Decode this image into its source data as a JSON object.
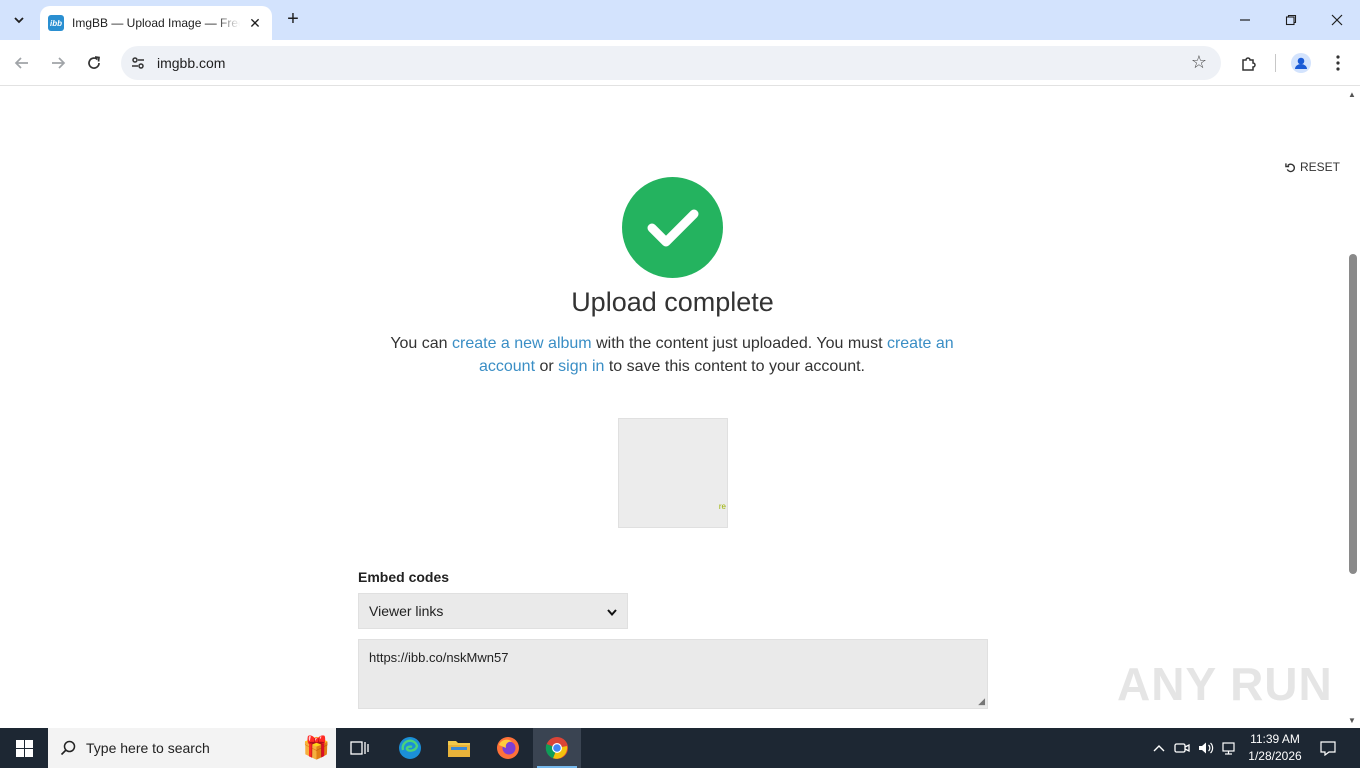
{
  "browser": {
    "tab_title": "ImgBB — Upload Image — Free Image Hosting",
    "favicon_text": "ibb",
    "url": "imgbb.com",
    "new_tab_label": "+",
    "close_tab_label": "✕"
  },
  "page": {
    "reset_label": "RESET",
    "title": "Upload complete",
    "desc_1": "You can ",
    "link_album": "create a new album",
    "desc_2": " with the content just uploaded. You must ",
    "link_account": "create an account",
    "desc_3": " or ",
    "link_signin": "sign in",
    "desc_4": " to save this content to your account.",
    "thumb_mark": "re",
    "embed_label": "Embed codes",
    "embed_selected": "Viewer links",
    "embed_value": "https://ibb.co/nskMwn57",
    "watermark": "ANY RUN"
  },
  "taskbar": {
    "search_placeholder": "Type here to search",
    "time": "11:39 AM",
    "date": "1/28/2026"
  },
  "colors": {
    "success": "#24b35f",
    "link": "#3a8ec5",
    "tabstrip": "#d3e3fd",
    "taskbar": "#1d2733"
  }
}
